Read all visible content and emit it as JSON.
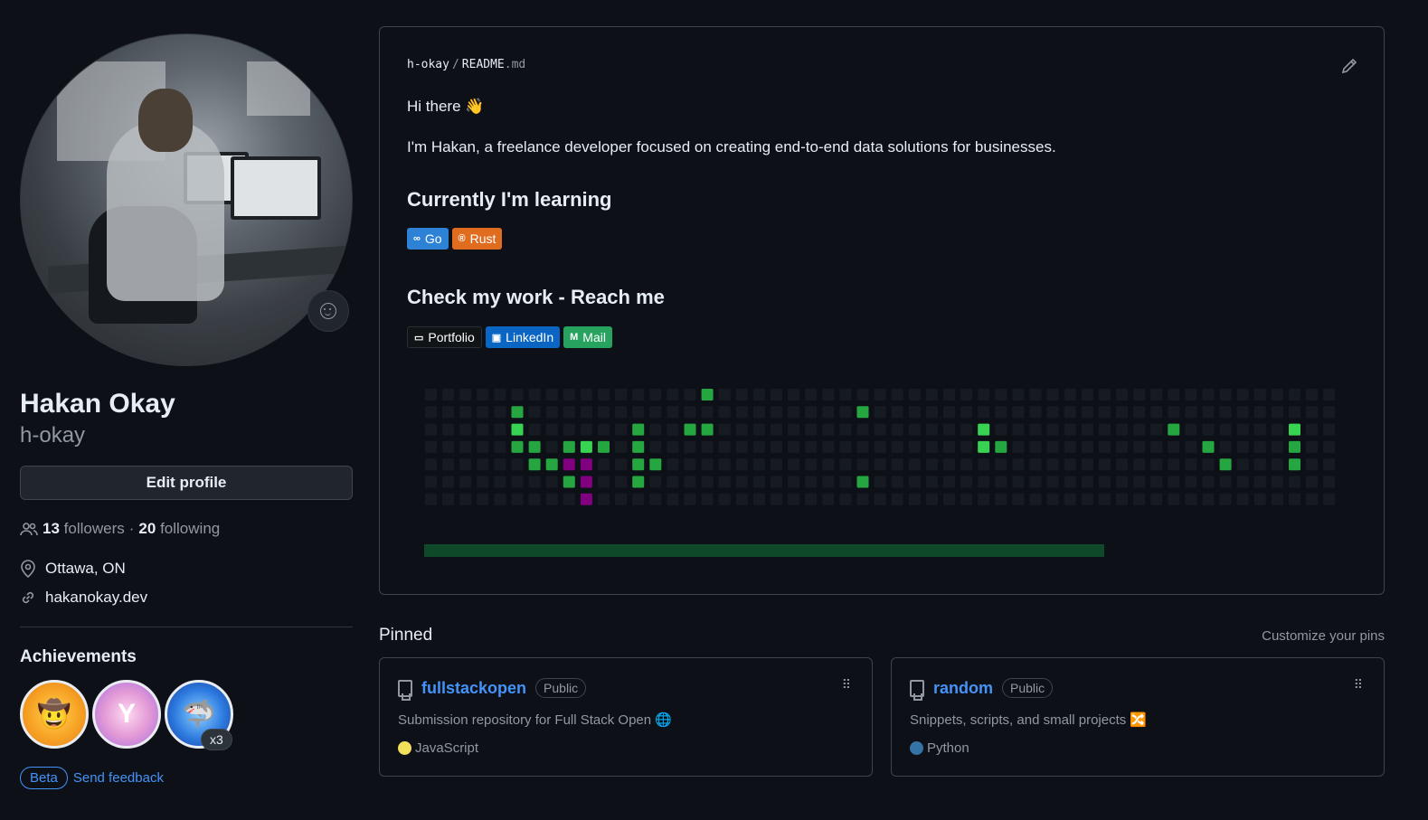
{
  "profile": {
    "name": "Hakan Okay",
    "login": "h-okay",
    "edit_label": "Edit profile",
    "followers_count": "13",
    "followers_label": "followers",
    "separator": "·",
    "following_count": "20",
    "following_label": "following",
    "location": "Ottawa, ON",
    "website": "hakanokay.dev"
  },
  "achievements": {
    "title": "Achievements",
    "badges": [
      "pull-shark-icon",
      "yolo-icon",
      "shark-icon"
    ],
    "multiplier": "x3",
    "beta_label": "Beta",
    "feedback_label": "Send feedback"
  },
  "readme": {
    "owner": "h-okay",
    "slash": "/",
    "file_base": "README",
    "file_ext": ".md",
    "greeting": "Hi there 👋",
    "intro": "I'm Hakan, a freelance developer focused on creating end-to-end data solutions for businesses.",
    "learning_heading": "Currently I'm learning",
    "learning_badges": [
      {
        "label": "Go",
        "color": "#2d82d6"
      },
      {
        "label": "Rust",
        "color": "#e06c20"
      }
    ],
    "contact_heading": "Check my work - Reach me",
    "contact_badges": [
      {
        "label": "Portfolio",
        "color": "#111417"
      },
      {
        "label": "LinkedIn",
        "color": "#0a66c2"
      },
      {
        "label": "Mail",
        "color": "#28a35f"
      }
    ]
  },
  "pinned": {
    "title": "Pinned",
    "customize_label": "Customize your pins",
    "repos": [
      {
        "name": "fullstackopen",
        "visibility": "Public",
        "description": "Submission repository for Full Stack Open 🌐",
        "language": "JavaScript",
        "language_color": "#f1e05a"
      },
      {
        "name": "random",
        "visibility": "Public",
        "description": "Snippets, scripts, and small projects 🔀",
        "language": "Python",
        "language_color": "#3572A5"
      }
    ]
  },
  "colors": {
    "background": "#0d1117",
    "link": "#4493f8",
    "contrib_empty": "#161b22",
    "contrib_green": "#26a641",
    "contrib_bright": "#39d353",
    "snake": "#800080"
  }
}
